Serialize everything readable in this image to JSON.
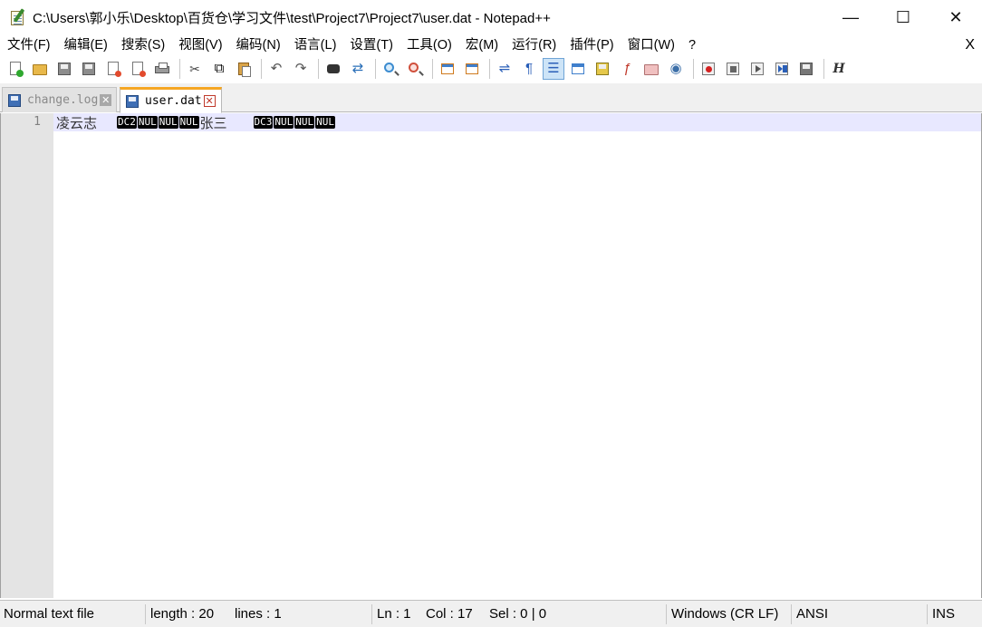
{
  "window": {
    "title": "C:\\Users\\郭小乐\\Desktop\\百货仓\\学习文件\\test\\Project7\\Project7\\user.dat - Notepad++",
    "minimize_glyph": "—",
    "maximize_glyph": "☐",
    "close_glyph": "✕"
  },
  "menu": {
    "items": [
      "文件(F)",
      "编辑(E)",
      "搜索(S)",
      "视图(V)",
      "编码(N)",
      "语言(L)",
      "设置(T)",
      "工具(O)",
      "宏(M)",
      "运行(R)",
      "插件(P)",
      "窗口(W)",
      "?"
    ],
    "close_glyph": "X"
  },
  "toolbar": {
    "icons": [
      "new-file-icon",
      "open-file-icon",
      "save-icon",
      "save-all-icon",
      "close-icon",
      "close-all-icon",
      "print-icon",
      "cut-icon",
      "copy-icon",
      "paste-icon",
      "undo-icon",
      "redo-icon",
      "find-icon",
      "replace-icon",
      "zoom-in-icon",
      "zoom-out-icon",
      "sync-vertical-icon",
      "sync-horizontal-icon",
      "word-wrap-icon",
      "show-all-chars-icon",
      "indent-guide-icon",
      "user-lang-icon",
      "doc-map-icon",
      "function-list-icon",
      "folder-workspace-icon",
      "monitoring-icon",
      "macro-record-icon",
      "macro-stop-icon",
      "macro-play-icon",
      "macro-run-multiple-icon",
      "macro-save-icon",
      "html-tag-icon"
    ],
    "glyphs": {
      "cut": "✂",
      "copy": "⧉",
      "undo": "↶",
      "redo": "↷",
      "replace": "⇄",
      "wrap": "⇌",
      "pilcrow": "¶",
      "indent": "☰",
      "func": "ƒ",
      "eye": "◉",
      "h": "H"
    },
    "active_icon": "indent-guide-icon"
  },
  "tabs": [
    {
      "label": "change.log",
      "active": false,
      "close_glyph": "✕"
    },
    {
      "label": "user.dat",
      "active": true,
      "close_glyph": "✕"
    }
  ],
  "editor": {
    "line_number": "1",
    "segments": {
      "name1": "凌云志",
      "cc1": [
        "DC2",
        "NUL",
        "NUL",
        "NUL"
      ],
      "name2": "张三",
      "cc2": [
        "DC3",
        "NUL",
        "NUL",
        "NUL"
      ]
    }
  },
  "status": {
    "file_type": "Normal text file",
    "length": "length : 20",
    "lines": "lines : 1",
    "ln": "Ln : 1",
    "col": "Col : 17",
    "sel": "Sel : 0 | 0",
    "eol": "Windows (CR LF)",
    "encoding": "ANSI",
    "mode": "INS"
  }
}
